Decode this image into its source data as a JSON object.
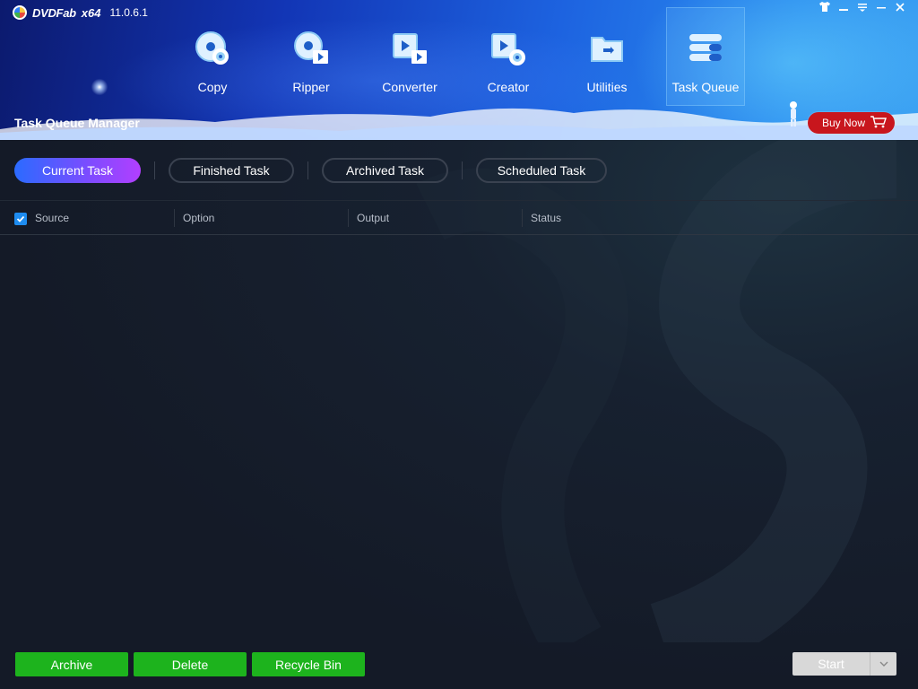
{
  "app": {
    "brand": "DVDFab",
    "arch": "x64",
    "version": "11.0.6.1"
  },
  "window_controls": [
    {
      "name": "skin-icon",
      "glyph": "👕"
    },
    {
      "name": "minimize-to-tray-icon",
      "glyph": "▬"
    },
    {
      "name": "menu-icon",
      "glyph": "≡"
    },
    {
      "name": "minimize-icon",
      "glyph": "—"
    },
    {
      "name": "close-icon",
      "glyph": "✕"
    }
  ],
  "nav": {
    "items": [
      {
        "label": "Copy",
        "icon": "copy-disc-icon"
      },
      {
        "label": "Ripper",
        "icon": "ripper-disc-icon"
      },
      {
        "label": "Converter",
        "icon": "converter-film-icon"
      },
      {
        "label": "Creator",
        "icon": "creator-film-icon"
      },
      {
        "label": "Utilities",
        "icon": "utilities-folder-icon"
      },
      {
        "label": "Task Queue",
        "icon": "task-queue-icon"
      }
    ],
    "active": "Task Queue"
  },
  "page_title": "Task Queue Manager",
  "buy_now": "Buy Now",
  "tabs": {
    "current": "Current Task",
    "finished": "Finished Task",
    "archived": "Archived Task",
    "scheduled": "Scheduled Task"
  },
  "table": {
    "columns": [
      "Source",
      "Option",
      "Output",
      "Status"
    ],
    "select_all_checked": true,
    "rows": []
  },
  "footer": {
    "archive": "Archive",
    "delete": "Delete",
    "recycle_bin": "Recycle Bin",
    "start": "Start"
  },
  "colors": {
    "header_blue": "#1235b5",
    "accent_green": "#1db31d",
    "buy_red": "#c8161d",
    "tab_gradient_start": "#2b6bff",
    "tab_gradient_end": "#b23fff",
    "start_disabled": "#d8d8d8"
  }
}
